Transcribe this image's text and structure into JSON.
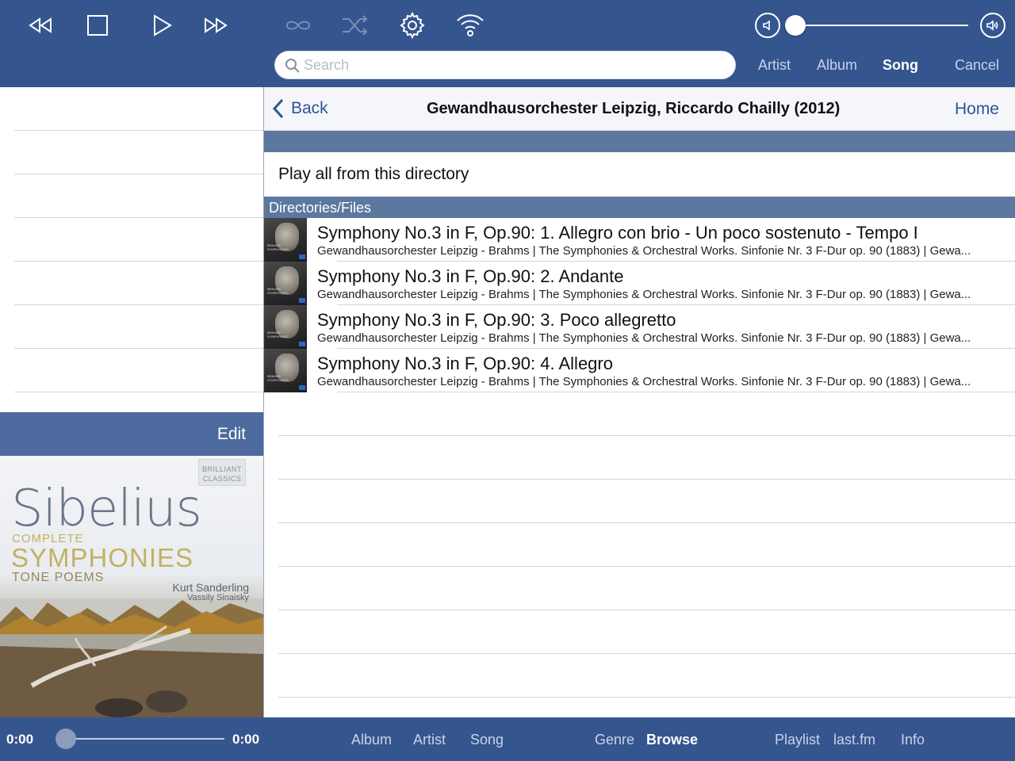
{
  "toolbar": {
    "icons": [
      "rewind-icon",
      "stop-icon",
      "play-icon",
      "fast-forward-icon",
      "repeat-icon",
      "shuffle-icon",
      "gear-icon",
      "wifi-icon",
      "volume-low-icon",
      "volume-high-icon"
    ],
    "volume_level": 0.0,
    "icon_color": "#ffffff",
    "disabled_icon_color": "#7c8fb5",
    "bar_color": "#35558f"
  },
  "search": {
    "placeholder": "Search",
    "value": "",
    "scopes": [
      "Artist",
      "Album",
      "Song"
    ],
    "active_scope": "Song",
    "cancel_label": "Cancel"
  },
  "left": {
    "edit_label": "Edit"
  },
  "album_art": {
    "brand": "BRILLIANT CLASSICS",
    "title": "Sibelius",
    "line1": "COMPLETE",
    "line2": "SYMPHONIES",
    "line3": "TONE POEMS",
    "conductor1": "Kurt Sanderling",
    "conductor2": "Vassily Sinaisky"
  },
  "nav": {
    "back_label": "Back",
    "title": "Gewandhausorchester Leipzig, Riccardo Chailly (2012)",
    "home_label": "Home"
  },
  "play_all_label": "Play all from this directory",
  "section_header": "Directories/Files",
  "files": [
    {
      "title": "Symphony No.3 in F, Op.90: 1. Allegro con brio - Un poco sostenuto - Tempo I",
      "subtitle": "Gewandhausorchester Leipzig - Brahms | The Symphonies & Orchestral Works. Sinfonie Nr. 3 F-Dur op. 90 (1883) | Gewa..."
    },
    {
      "title": "Symphony No.3 in F, Op.90: 2. Andante",
      "subtitle": "Gewandhausorchester Leipzig - Brahms | The Symphonies & Orchestral Works. Sinfonie Nr. 3 F-Dur op. 90 (1883) | Gewa..."
    },
    {
      "title": "Symphony No.3 in F, Op.90: 3. Poco allegretto",
      "subtitle": "Gewandhausorchester Leipzig - Brahms | The Symphonies & Orchestral Works. Sinfonie Nr. 3 F-Dur op. 90 (1883) | Gewa..."
    },
    {
      "title": "Symphony No.3 in F, Op.90: 4. Allegro",
      "subtitle": "Gewandhausorchester Leipzig - Brahms | The Symphonies & Orchestral Works. Sinfonie Nr. 3 F-Dur op. 90 (1883) | Gewa..."
    }
  ],
  "player": {
    "time_elapsed": "0:00",
    "time_total": "0:00",
    "progress": 0.0
  },
  "bottom_tabs": {
    "album": "Album",
    "artist": "Artist",
    "song": "Song",
    "genre": "Genre",
    "browse": "Browse",
    "playlist": "Playlist",
    "lastfm": "last.fm",
    "info": "Info",
    "active": "Browse"
  }
}
